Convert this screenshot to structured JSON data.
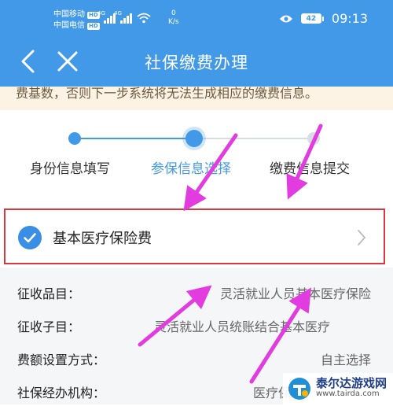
{
  "status_bar": {
    "carrier1": "中国移动",
    "carrier2": "中国电信",
    "hd_badge": "HD",
    "net_type": "4G",
    "speed_value": "0",
    "speed_unit": "K/s",
    "battery": "42",
    "time": "09:13"
  },
  "nav": {
    "title": "社保缴费办理"
  },
  "notice": {
    "text": "费基数，否则下一步系统将无法生成相应的缴费信息。"
  },
  "stepper": {
    "steps": [
      {
        "label": "身份信息填写",
        "state": "done"
      },
      {
        "label": "参保信息选择",
        "state": "active"
      },
      {
        "label": "缴费信息提交",
        "state": "pending"
      }
    ]
  },
  "selected_item": {
    "label": "基本医疗保险费",
    "checked": true
  },
  "details": [
    {
      "key": "征收品目：",
      "value": "灵活就业人员基本医疗保险"
    },
    {
      "key": "征收子目：",
      "value": "灵活就业人员统账结合基本医疗"
    },
    {
      "key": "费额设置方式：",
      "value": "自主选择"
    },
    {
      "key": "社保经办机构：",
      "value": "医疗保"
    }
  ],
  "watermark": {
    "name": "泰尔达游戏网",
    "url": "www.tairda.com"
  },
  "colors": {
    "primary": "#4199e7",
    "highlight_border": "#d9383f",
    "annotation_arrow": "#e23ce0",
    "notice_bg": "#fdf3e4"
  }
}
